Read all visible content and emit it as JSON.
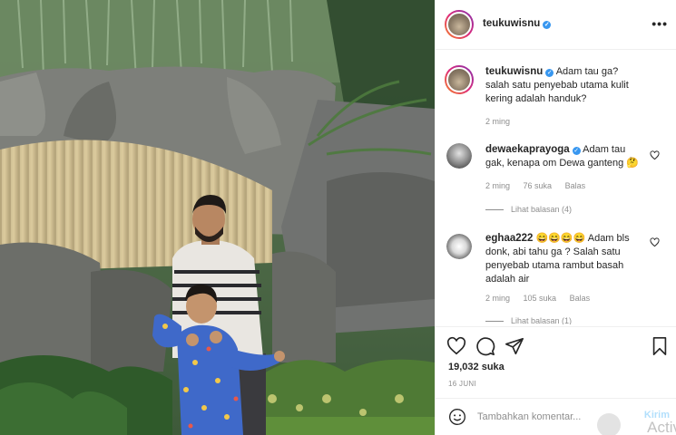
{
  "post": {
    "username": "teukuwisnu",
    "verified_mark": "✓",
    "more_label": "•••",
    "photo_description_icon": "photo"
  },
  "caption": {
    "username": "teukuwisnu",
    "text": "Adam tau ga? salah satu penyebab utama kulit kering adalah handuk?",
    "time": "2 ming"
  },
  "comments": [
    {
      "username": "dewaekaprayoga",
      "text": "Adam tau gak, kenapa om Dewa ganteng 🤔",
      "time": "2 ming",
      "likes": "76 suka",
      "reply": "Balas",
      "view_replies": "Lihat balasan (4)"
    },
    {
      "username": "eghaa222",
      "text": "😄😄😄😄 Adam bls donk, abi tahu ga ? Salah satu penyebab utama rambut basah adalah air",
      "time": "2 ming",
      "likes": "105 suka",
      "reply": "Balas",
      "view_replies": "Lihat balasan (1)"
    }
  ],
  "actions": {
    "like_icon": "heart-icon",
    "comment_icon": "comment-icon",
    "share_icon": "share-icon",
    "save_icon": "bookmark-icon",
    "likes_count": "19,032 suka",
    "date": "16 JUNI"
  },
  "add_comment": {
    "placeholder": "Tambahkan komentar...",
    "post_label": "Kirim",
    "overlay_text": "Activ"
  },
  "colors": {
    "verified": "#3897f0",
    "muted": "#8e8e8e",
    "text": "#262626",
    "post_button": "#b2dffc"
  }
}
